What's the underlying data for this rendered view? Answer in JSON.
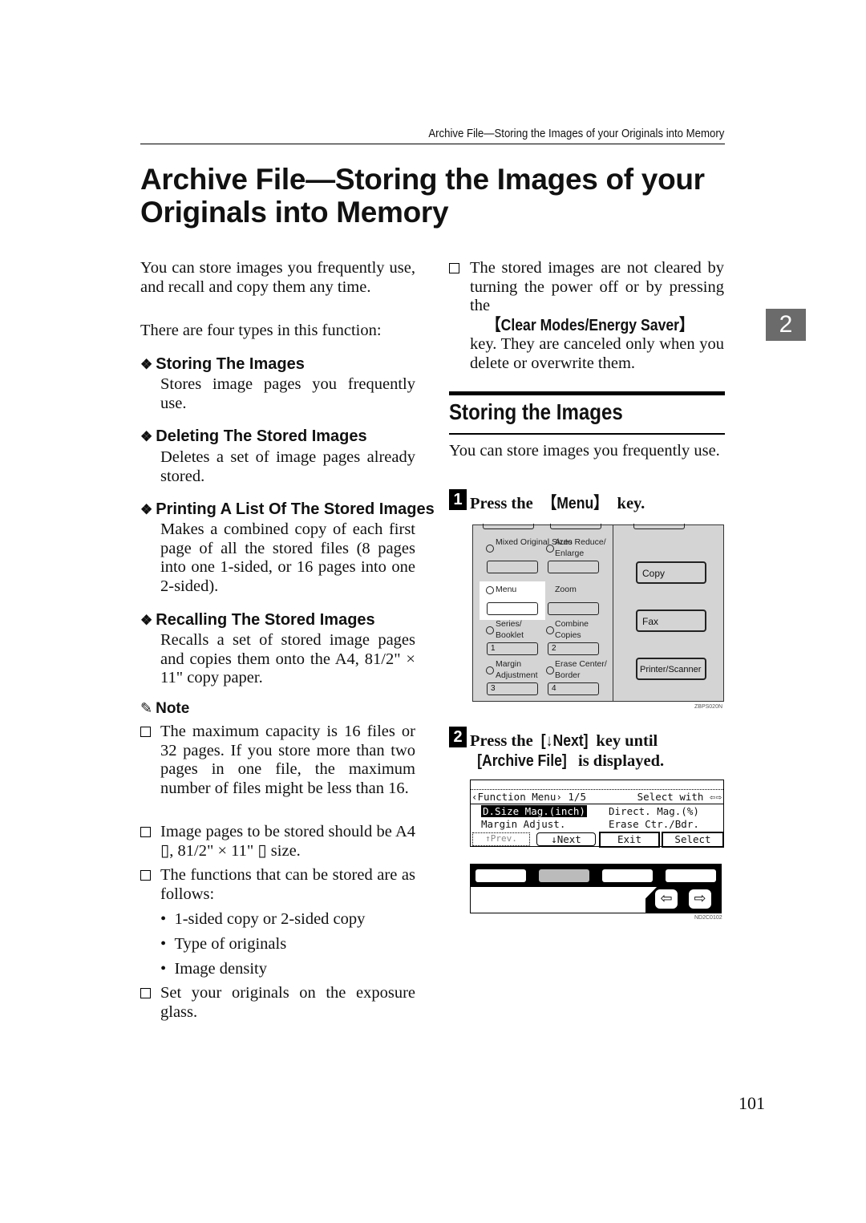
{
  "running_header": "Archive File—Storing the Images of your Originals into Memory",
  "title": "Archive File—Storing the Images of your Originals into Memory",
  "chapter_tab": "2",
  "left": {
    "intro": "You can store images you frequently use, and recall and copy them any time.",
    "types_intro": "There are four types in this function:",
    "types": [
      {
        "heading": "Storing The Images",
        "text": "Stores image pages you frequently use."
      },
      {
        "heading": "Deleting The Stored Images",
        "text": "Deletes a set of image pages already stored."
      },
      {
        "heading": "Printing A List Of The Stored Images",
        "text": "Makes a combined copy of each first page of all the stored files (8 pages into one 1-sided, or 16 pages into one 2-sided)."
      },
      {
        "heading": "Recalling The Stored Images",
        "text": "Recalls a set of stored image pages and copies them onto the A4, 81/2\" × 11\" copy paper."
      }
    ],
    "note_label": "Note",
    "notes": [
      "The maximum capacity is 16 files or 32 pages. If you store more than two pages in one file, the maximum number of files might be less than 16.",
      "Image pages to be stored should be A4 ▯, 81/2\" × 11\" ▯ size.",
      "The functions that can be stored are as follows:"
    ],
    "bullets": [
      "1-sided copy or 2-sided copy",
      "Type of originals",
      "Image density"
    ],
    "last_note": "Set your originals on the exposure glass."
  },
  "right": {
    "note_pre": "The stored images are not cleared by turning the power off or by pressing the ",
    "note_key": "【Clear Modes/Energy Saver】",
    "note_post": " key. They are canceled only when you delete or overwrite them.",
    "section_heading": "Storing the Images",
    "section_intro": "You can store images you frequently use.",
    "step1": {
      "num": "1",
      "pre": "Press the ",
      "key": "【Menu】",
      "post": " key."
    },
    "step2": {
      "num": "2",
      "pre": "Press the ",
      "key1": "[↓Next]",
      "mid": " key until ",
      "key2": "[Archive File]",
      "post": " is displayed."
    },
    "panel": {
      "labels": [
        "Mixed Original Sizes",
        "Auto Reduce/ Enlarge",
        "Menu",
        "Zoom",
        "Series/ Booklet",
        "Combine Copies",
        "Margin Adjustment",
        "Erase Center/ Border"
      ],
      "numbers": [
        "1",
        "2",
        "3",
        "4"
      ],
      "buttons": [
        "Copy",
        "Fax",
        "Printer/Scanner"
      ],
      "code": "ZBPS020N"
    },
    "lcd": {
      "header_left": "‹Function Menu› 1/5",
      "header_right": "Select with ⇦⇨",
      "item_selected": "D.Size Mag.(inch)",
      "item2": "Direct. Mag.(%)",
      "item3": "Margin Adjust.",
      "item4": "Erase Ctr./Bdr.",
      "softkeys": [
        "↑Prev.",
        "↓Next",
        "Exit",
        "Select"
      ],
      "code": "ND2C0102"
    }
  },
  "page_number": "101"
}
